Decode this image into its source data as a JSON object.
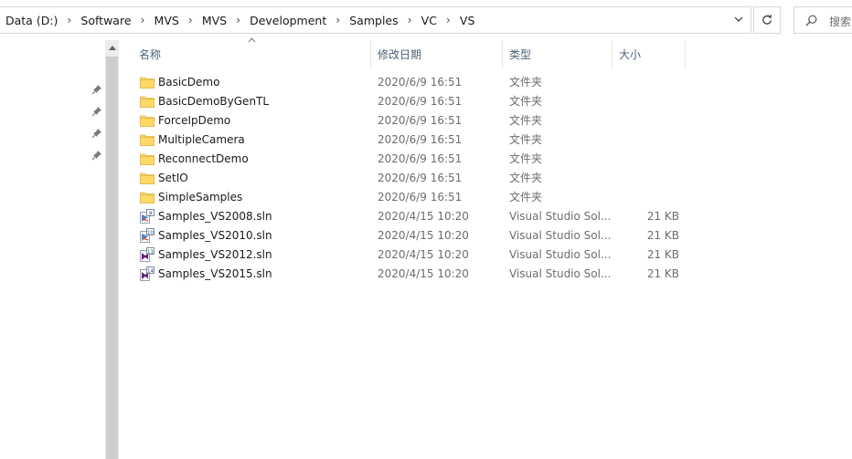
{
  "address": {
    "crumbs": [
      "Data (D:)",
      "Software",
      "MVS",
      "MVS",
      "Development",
      "Samples",
      "VC",
      "VS"
    ]
  },
  "search": {
    "placeholder": "搜索"
  },
  "columns": {
    "name": "名称",
    "date": "修改日期",
    "type": "类型",
    "size": "大小"
  },
  "rows": [
    {
      "name": "BasicDemo",
      "date": "2020/6/9 16:51",
      "type": "文件夹",
      "size": "",
      "icon": "folder-icon"
    },
    {
      "name": "BasicDemoByGenTL",
      "date": "2020/6/9 16:51",
      "type": "文件夹",
      "size": "",
      "icon": "folder-icon"
    },
    {
      "name": "ForceIpDemo",
      "date": "2020/6/9 16:51",
      "type": "文件夹",
      "size": "",
      "icon": "folder-icon"
    },
    {
      "name": "MultipleCamera",
      "date": "2020/6/9 16:51",
      "type": "文件夹",
      "size": "",
      "icon": "folder-icon"
    },
    {
      "name": "ReconnectDemo",
      "date": "2020/6/9 16:51",
      "type": "文件夹",
      "size": "",
      "icon": "folder-icon"
    },
    {
      "name": "SetIO",
      "date": "2020/6/9 16:51",
      "type": "文件夹",
      "size": "",
      "icon": "folder-icon"
    },
    {
      "name": "SimpleSamples",
      "date": "2020/6/9 16:51",
      "type": "文件夹",
      "size": "",
      "icon": "folder-icon"
    },
    {
      "name": "Samples_VS2008.sln",
      "date": "2020/4/15 10:20",
      "type": "Visual Studio Sol...",
      "size": "21 KB",
      "icon": "vs2008-solution-icon",
      "badge": "9"
    },
    {
      "name": "Samples_VS2010.sln",
      "date": "2020/4/15 10:20",
      "type": "Visual Studio Sol...",
      "size": "21 KB",
      "icon": "vs2010-solution-icon",
      "badge": "10"
    },
    {
      "name": "Samples_VS2012.sln",
      "date": "2020/4/15 10:20",
      "type": "Visual Studio Sol...",
      "size": "21 KB",
      "icon": "vs2012-solution-icon",
      "badge": "11"
    },
    {
      "name": "Samples_VS2015.sln",
      "date": "2020/4/15 10:20",
      "type": "Visual Studio Sol...",
      "size": "21 KB",
      "icon": "vs2015-solution-icon",
      "badge": "14"
    }
  ],
  "colors": {
    "header_text": "#4c607a",
    "folder": "#f8d775",
    "detail_text": "#6d6d6d",
    "vs_purple": "#68217a"
  }
}
